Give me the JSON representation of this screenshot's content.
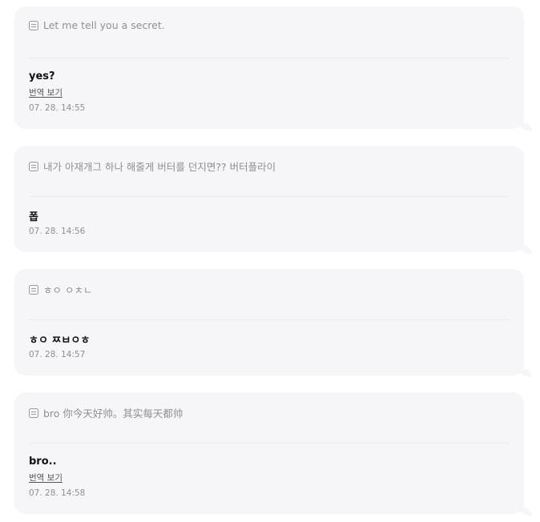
{
  "messages": [
    {
      "question": "Let me tell you a secret.",
      "answer": "yes?",
      "translate_label": "번역 보기",
      "time": "07. 28. 14:55"
    },
    {
      "question": "내가 아재개그 하나 해줄게 버터를 던지면?? 버터플라이",
      "answer": "폽",
      "time": "07. 28. 14:56"
    },
    {
      "question": "ㅎㅇ ㅇㅊㄴ",
      "answer": "ㅎㅇ ㅉㅂㅇㅎ",
      "time": "07. 28. 14:57"
    },
    {
      "question": "bro 你今天好帅。其实每天都帅",
      "answer": "bro..",
      "translate_label": "번역 보기",
      "time": "07. 28. 14:58"
    }
  ]
}
